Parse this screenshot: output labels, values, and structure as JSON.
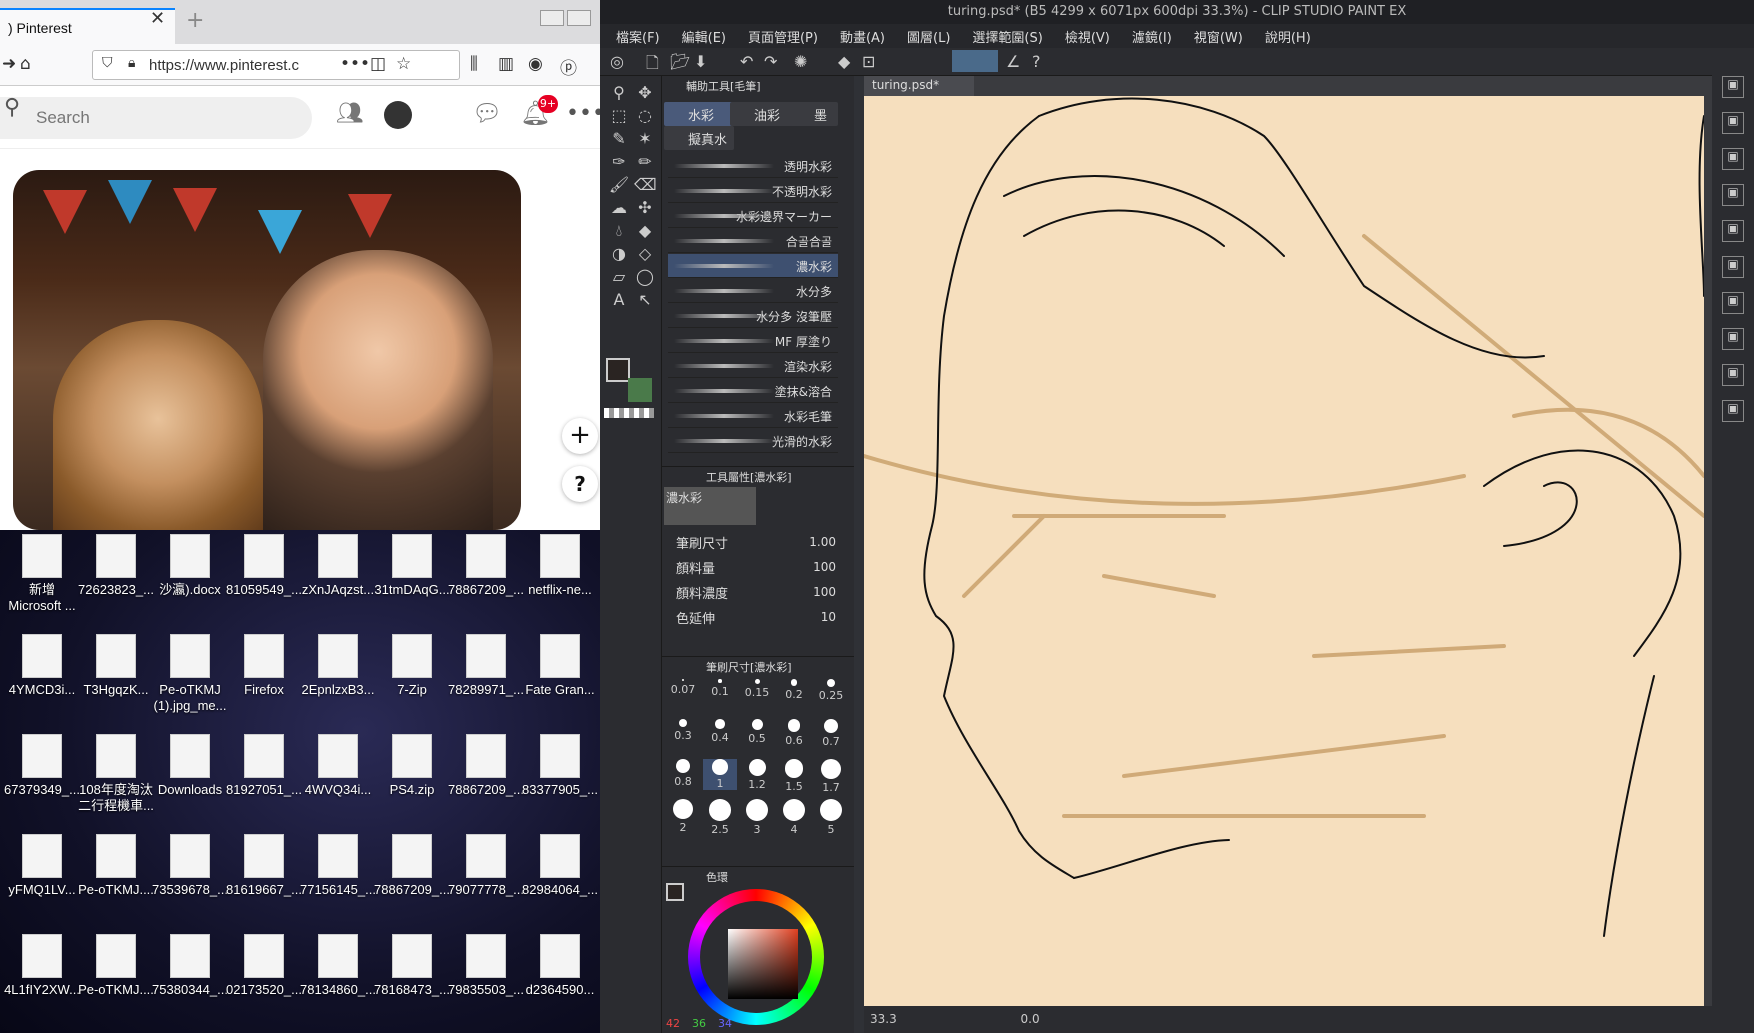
{
  "firefox": {
    "tab_title": ") Pinterest",
    "url": "https://www.pinterest.c",
    "search_placeholder": "Search",
    "notif_count": "9+"
  },
  "desktop": {
    "icons": [
      {
        "label": "新增 Microsoft ..."
      },
      {
        "label": "72623823_..."
      },
      {
        "label": "沙瀛).docx"
      },
      {
        "label": "81059549_..."
      },
      {
        "label": "zXnJAqzst..."
      },
      {
        "label": "31tmDAqG..."
      },
      {
        "label": "78867209_..."
      },
      {
        "label": "netflix-ne..."
      },
      {
        "label": "4YMCD3i..."
      },
      {
        "label": "T3HgqzK..."
      },
      {
        "label": "Pe-oTKMJ (1).jpg_me..."
      },
      {
        "label": "Firefox"
      },
      {
        "label": "2EpnlzxB3..."
      },
      {
        "label": "7-Zip"
      },
      {
        "label": "78289971_..."
      },
      {
        "label": "Fate Gran..."
      },
      {
        "label": "67379349_..."
      },
      {
        "label": "108年度淘汰 二行程機車..."
      },
      {
        "label": "Downloads"
      },
      {
        "label": "81927051_..."
      },
      {
        "label": "4WVQ34i..."
      },
      {
        "label": "PS4.zip"
      },
      {
        "label": "78867209_..."
      },
      {
        "label": "83377905_..."
      },
      {
        "label": "yFMQ1LV..."
      },
      {
        "label": "Pe-oTKMJ...."
      },
      {
        "label": "73539678_..."
      },
      {
        "label": "81619667_..."
      },
      {
        "label": "77156145_..."
      },
      {
        "label": "78867209_..."
      },
      {
        "label": "79077778_..."
      },
      {
        "label": "82984064_..."
      },
      {
        "label": "4L1fIY2XW..."
      },
      {
        "label": "Pe-oTKMJ...."
      },
      {
        "label": "75380344_..."
      },
      {
        "label": "02173520_..."
      },
      {
        "label": "78134860_..."
      },
      {
        "label": "78168473_..."
      },
      {
        "label": "79835503_..."
      },
      {
        "label": "d2364590..."
      }
    ]
  },
  "csp": {
    "title": "turing.psd* (B5 4299 x 6071px 600dpi 33.3%) - CLIP STUDIO PAINT EX",
    "menu": [
      "檔案(F)",
      "編輯(E)",
      "頁面管理(P)",
      "動畫(A)",
      "圖層(L)",
      "選擇範圍(S)",
      "檢視(V)",
      "濾鏡(I)",
      "視窗(W)",
      "說明(H)"
    ],
    "sub_tool_header": "輔助工具[毛筆]",
    "sub_tabs": [
      "水彩",
      "油彩",
      "墨",
      "擬真水"
    ],
    "brushes": [
      "透明水彩",
      "不透明水彩",
      "水彩邊界マーカー",
      "合골合골",
      "濃水彩",
      "水分多",
      "水分多 沒筆壓",
      "MF 厚塗り",
      "渲染水彩",
      "塗抹&溶合",
      "水彩毛筆",
      "光滑的水彩"
    ],
    "prop_header": "工具屬性[濃水彩]",
    "prop_preview_label": "濃水彩",
    "props": [
      {
        "label": "筆刷尺寸",
        "value": "1.00"
      },
      {
        "label": "顏料量",
        "value": "100"
      },
      {
        "label": "顏料濃度",
        "value": "100"
      },
      {
        "label": "色延伸",
        "value": "10"
      }
    ],
    "size_header": "筆刷尺寸[濃水彩]",
    "sizes": [
      "0.07",
      "0.1",
      "0.15",
      "0.2",
      "0.25",
      "0.3",
      "0.4",
      "0.5",
      "0.6",
      "0.7",
      "0.8",
      "1",
      "1.2",
      "1.5",
      "1.7",
      "2",
      "2.5",
      "3",
      "4",
      "5"
    ],
    "color_header": "色環",
    "rgb": {
      "r": "42",
      "g": "36",
      "b": "34"
    },
    "canvas_tab": "turing.psd*",
    "zoom": "33.3",
    "rotation": "0.0"
  }
}
